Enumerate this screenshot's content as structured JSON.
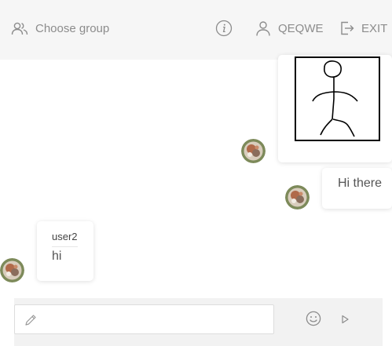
{
  "header": {
    "choose_group_label": "Choose group",
    "username_label": "QEQWE",
    "exit_label": "EXIT"
  },
  "messages": [
    {
      "sender": "self",
      "type": "drawing",
      "drawing": "stick-figure"
    },
    {
      "sender": "self",
      "type": "text",
      "text": "Hi there"
    },
    {
      "sender": "user2",
      "type": "text",
      "sender_name": "user2",
      "text": "hi"
    }
  ],
  "composer": {
    "value": "",
    "placeholder": ""
  },
  "colors": {
    "header_bg": "#f6f6f6",
    "icon_gray": "#8c8c8c",
    "composer_bg": "#f2f2f2"
  }
}
